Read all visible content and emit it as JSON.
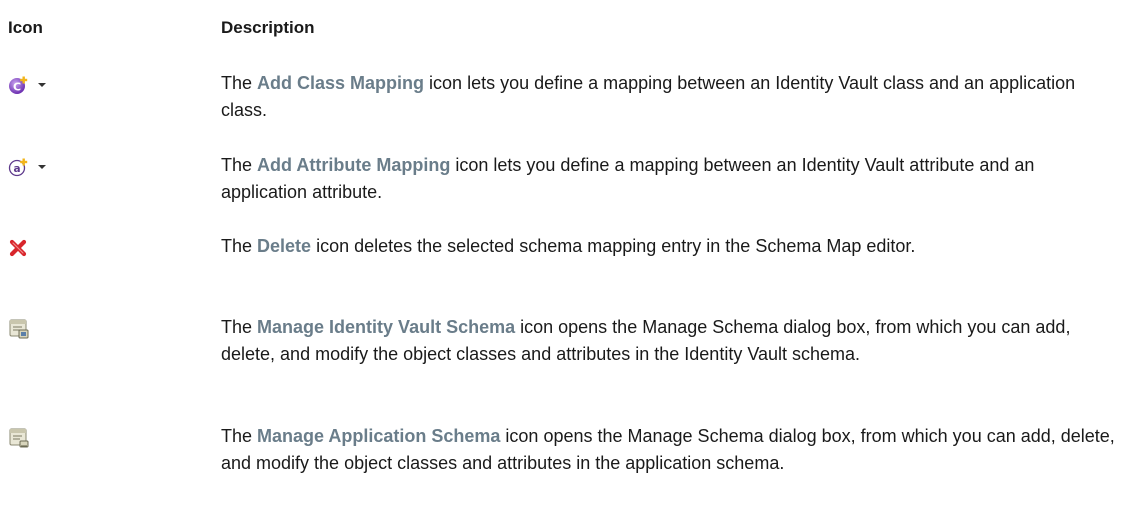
{
  "headers": {
    "icon": "Icon",
    "description": "Description"
  },
  "rows": [
    {
      "icon": "add-class-mapping-icon",
      "highlight": "Add Class Mapping",
      "before": "The ",
      "after": " icon lets you define a mapping between an Identity Vault class and an application class."
    },
    {
      "icon": "add-attribute-mapping-icon",
      "highlight": "Add Attribute Mapping",
      "before": "The ",
      "after": " icon lets you define a mapping between an Identity Vault attribute and an application attribute."
    },
    {
      "icon": "delete-icon",
      "highlight": "Delete",
      "before": "The ",
      "after": " icon deletes the selected schema mapping entry in the Schema Map editor."
    },
    {
      "icon": "manage-identity-vault-schema-icon",
      "highlight": "Manage Identity Vault Schema",
      "before": "The ",
      "after": " icon opens the Manage Schema dialog box, from which you can add, delete, and modify the object classes and attributes in the Identity Vault schema."
    },
    {
      "icon": "manage-application-schema-icon",
      "highlight": "Manage Application Schema",
      "before": "The ",
      "after": " icon opens the Manage Schema dialog box, from which you can add, delete, and modify the object classes and attributes in the application schema."
    }
  ],
  "colors": {
    "highlight": "#6a7d8a",
    "text": "#1a1a1a",
    "delete_red": "#d8262c"
  }
}
